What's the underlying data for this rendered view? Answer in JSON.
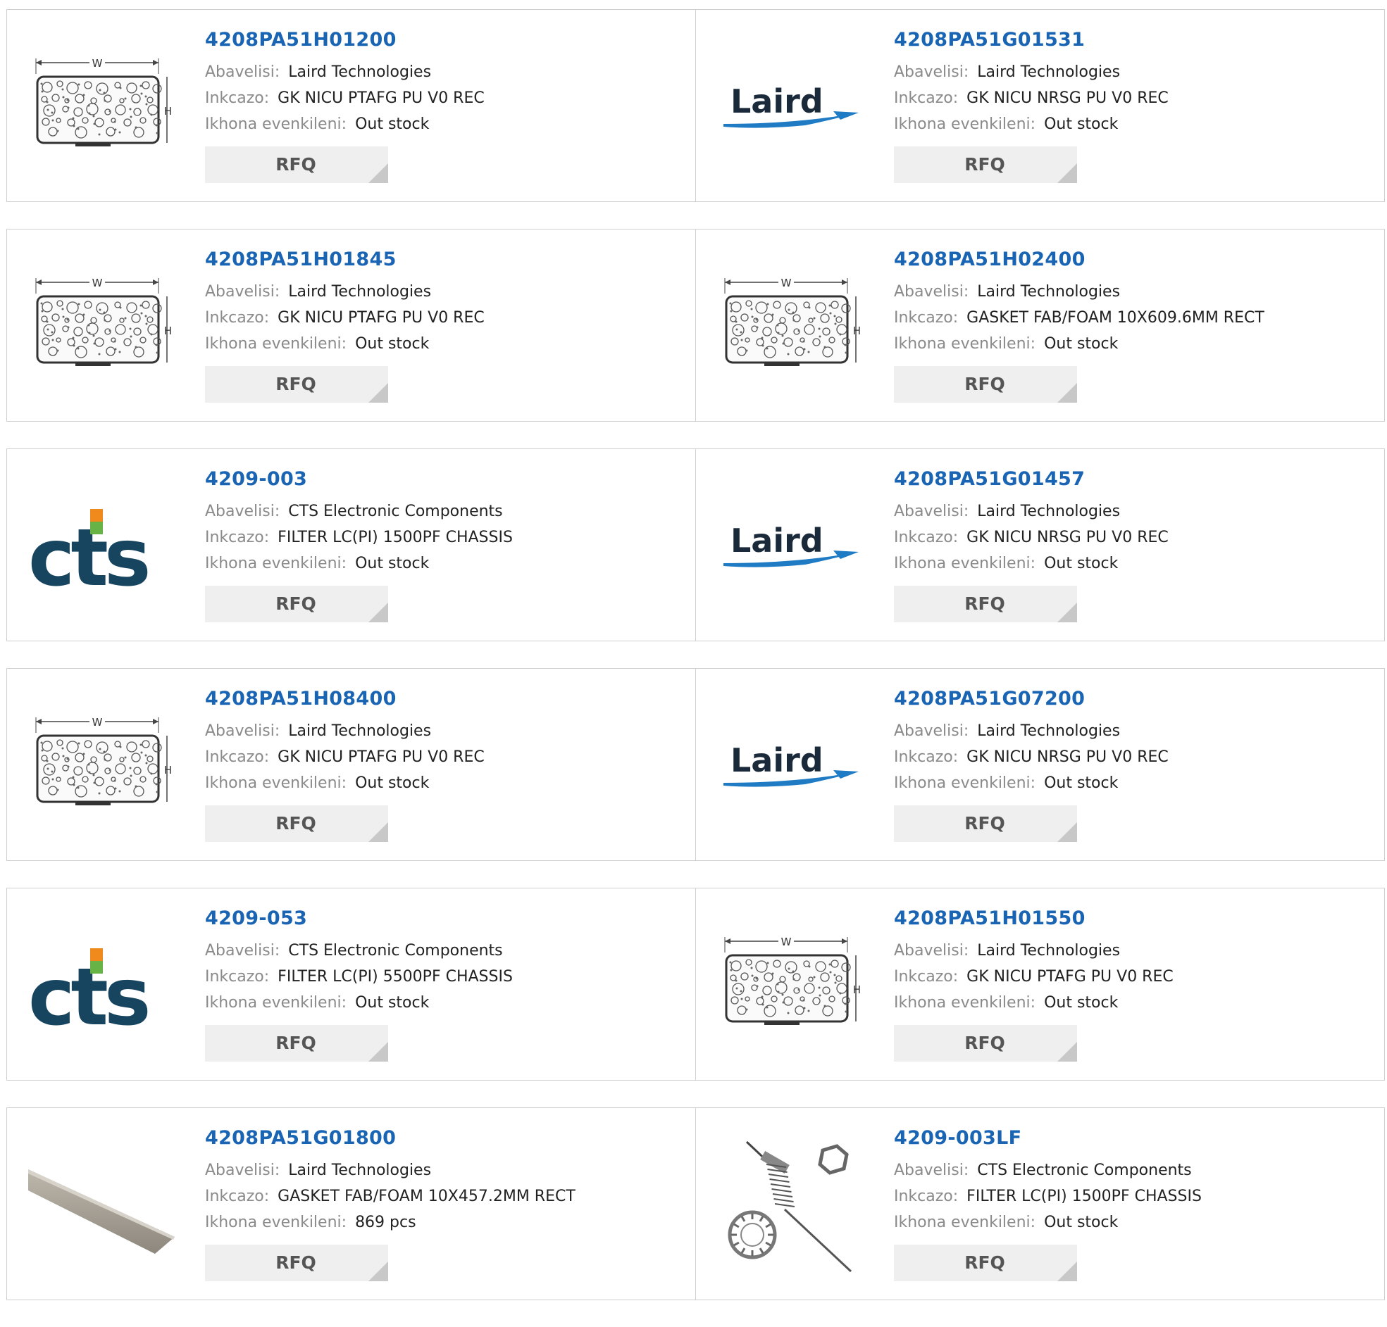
{
  "labels": {
    "manufacturer": "Abavelisi:",
    "description": "Inkcazo:",
    "stock": "Ikhona evenkileni:",
    "rfq": "RFQ"
  },
  "products": [
    {
      "part": "4208PA51H01200",
      "manufacturer": "Laird Technologies",
      "description": "GK NICU PTAFG PU V0 REC",
      "stock": "Out stock",
      "image": "gasket-diagram"
    },
    {
      "part": "4208PA51G01531",
      "manufacturer": "Laird Technologies",
      "description": "GK NICU NRSG PU V0 REC",
      "stock": "Out stock",
      "image": "laird-logo"
    },
    {
      "part": "4208PA51H01845",
      "manufacturer": "Laird Technologies",
      "description": "GK NICU PTAFG PU V0 REC",
      "stock": "Out stock",
      "image": "gasket-diagram"
    },
    {
      "part": "4208PA51H02400",
      "manufacturer": "Laird Technologies",
      "description": "GASKET FAB/FOAM 10X609.6MM RECT",
      "stock": "Out stock",
      "image": "gasket-diagram"
    },
    {
      "part": "4209-003",
      "manufacturer": "CTS Electronic Components",
      "description": "FILTER LC(PI) 1500PF CHASSIS",
      "stock": "Out stock",
      "image": "cts-logo"
    },
    {
      "part": "4208PA51G01457",
      "manufacturer": "Laird Technologies",
      "description": "GK NICU NRSG PU V0 REC",
      "stock": "Out stock",
      "image": "laird-logo"
    },
    {
      "part": "4208PA51H08400",
      "manufacturer": "Laird Technologies",
      "description": "GK NICU PTAFG PU V0 REC",
      "stock": "Out stock",
      "image": "gasket-diagram"
    },
    {
      "part": "4208PA51G07200",
      "manufacturer": "Laird Technologies",
      "description": "GK NICU NRSG PU V0 REC",
      "stock": "Out stock",
      "image": "laird-logo"
    },
    {
      "part": "4209-053",
      "manufacturer": "CTS Electronic Components",
      "description": "FILTER LC(PI) 5500PF CHASSIS",
      "stock": "Out stock",
      "image": "cts-logo"
    },
    {
      "part": "4208PA51H01550",
      "manufacturer": "Laird Technologies",
      "description": "GK NICU PTAFG PU V0 REC",
      "stock": "Out stock",
      "image": "gasket-diagram"
    },
    {
      "part": "4208PA51G01800",
      "manufacturer": "Laird Technologies",
      "description": "GASKET FAB/FOAM 10X457.2MM RECT",
      "stock": "869 pcs",
      "image": "gasket-strip-photo"
    },
    {
      "part": "4209-003LF",
      "manufacturer": "CTS Electronic Components",
      "description": "FILTER LC(PI) 1500PF CHASSIS",
      "stock": "Out stock",
      "image": "filter-hardware-photo"
    }
  ],
  "logos": {
    "laird_text": "Laird",
    "cts_text": "CTS"
  },
  "colors": {
    "link_blue": "#1a64b4",
    "label_gray": "#8a8a8a",
    "rfq_bg": "#efefef",
    "laird_blue": "#1f7bc4",
    "cts_navy": "#17455f",
    "cts_orange": "#f08a1c",
    "cts_green": "#68b345"
  }
}
